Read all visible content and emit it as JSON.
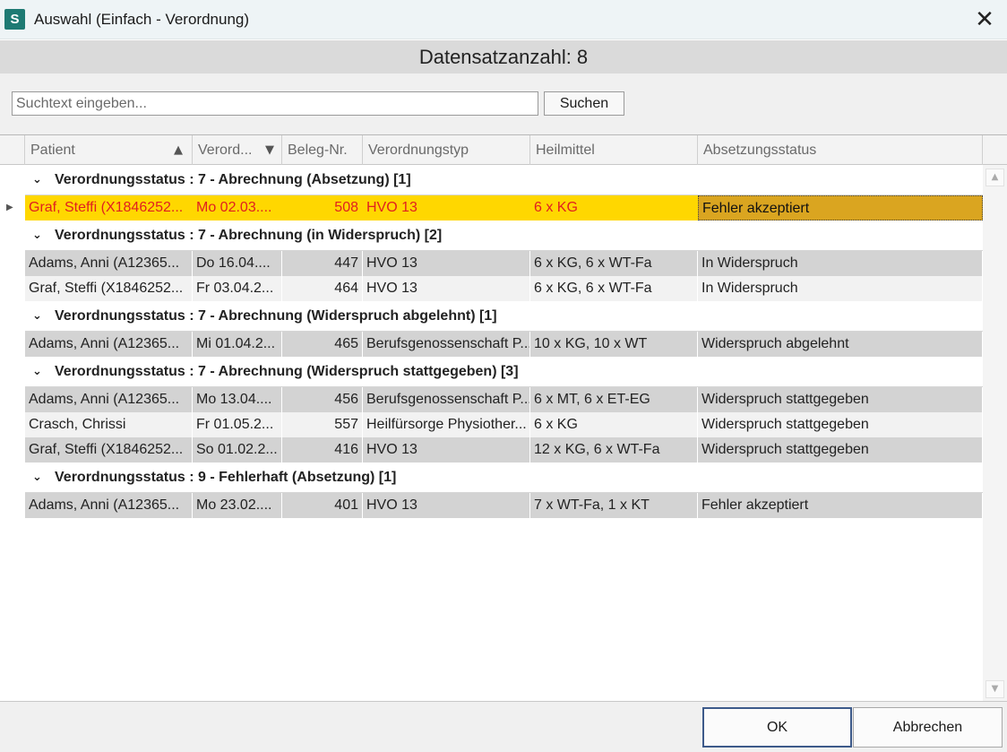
{
  "window": {
    "icon_letter": "S",
    "title": "Auswahl (Einfach - Verordnung)",
    "close_symbol": "✕"
  },
  "record_count": "Datensatzanzahl: 8",
  "search": {
    "placeholder": "Suchtext eingeben...",
    "value": "",
    "button_label": "Suchen"
  },
  "columns": [
    {
      "label": "Patient",
      "sort": "asc"
    },
    {
      "label": "Verord...",
      "sort": "desc"
    },
    {
      "label": "Beleg-Nr."
    },
    {
      "label": "Verordnungstyp"
    },
    {
      "label": "Heilmittel"
    },
    {
      "label": "Absetzungsstatus"
    }
  ],
  "sort_icons": {
    "asc": "▲",
    "desc": "▼"
  },
  "groups": [
    {
      "label": "Verordnungsstatus : 7 - Abrechnung (Absetzung) [1]",
      "rows": [
        {
          "patient": "Graf, Steffi (X1846252...",
          "datum": "Mo 02.03....",
          "beleg": "508",
          "typ": "HVO 13",
          "heilmittel": "6 x KG",
          "status": "Fehler akzeptiert",
          "selected": true
        }
      ]
    },
    {
      "label": "Verordnungsstatus : 7 - Abrechnung (in Widerspruch) [2]",
      "rows": [
        {
          "patient": "Adams, Anni (A12365...",
          "datum": "Do 16.04....",
          "beleg": "447",
          "typ": "HVO 13",
          "heilmittel": "6 x KG, 6 x WT-Fa",
          "status": "In Widerspruch"
        },
        {
          "patient": "Graf, Steffi (X1846252...",
          "datum": "Fr 03.04.2...",
          "beleg": "464",
          "typ": "HVO 13",
          "heilmittel": "6 x KG, 6 x WT-Fa",
          "status": "In Widerspruch"
        }
      ]
    },
    {
      "label": "Verordnungsstatus : 7 - Abrechnung (Widerspruch abgelehnt) [1]",
      "rows": [
        {
          "patient": "Adams, Anni (A12365...",
          "datum": "Mi 01.04.2...",
          "beleg": "465",
          "typ": "Berufsgenossenschaft P...",
          "heilmittel": "10 x KG, 10 x WT",
          "status": "Widerspruch abgelehnt"
        }
      ]
    },
    {
      "label": "Verordnungsstatus : 7 - Abrechnung (Widerspruch stattgegeben) [3]",
      "rows": [
        {
          "patient": "Adams, Anni (A12365...",
          "datum": "Mo 13.04....",
          "beleg": "456",
          "typ": "Berufsgenossenschaft P...",
          "heilmittel": "6 x MT, 6 x ET-EG",
          "status": "Widerspruch stattgegeben"
        },
        {
          "patient": "Crasch, Chrissi",
          "datum": "Fr 01.05.2...",
          "beleg": "557",
          "typ": "Heilfürsorge Physiother...",
          "heilmittel": "6 x KG",
          "status": "Widerspruch stattgegeben"
        },
        {
          "patient": "Graf, Steffi (X1846252...",
          "datum": "So 01.02.2...",
          "beleg": "416",
          "typ": "HVO 13",
          "heilmittel": "12 x KG, 6 x WT-Fa",
          "status": "Widerspruch stattgegeben"
        }
      ]
    },
    {
      "label": "Verordnungsstatus : 9 - Fehlerhaft (Absetzung) [1]",
      "rows": [
        {
          "patient": "Adams, Anni (A12365...",
          "datum": "Mo 23.02....",
          "beleg": "401",
          "typ": "HVO 13",
          "heilmittel": "7 x WT-Fa, 1 x KT",
          "status": "Fehler akzeptiert"
        }
      ]
    }
  ],
  "icons": {
    "group_expanded": "⌄",
    "row_indicator": "▶",
    "scroll_up": "▲",
    "scroll_down": "▼"
  },
  "colors": {
    "selected_row": "#ffd700",
    "selected_status": "#daa520",
    "selected_text": "#e02020",
    "app_icon": "#1e7a73"
  },
  "footer": {
    "ok_label": "OK",
    "cancel_label": "Abbrechen"
  }
}
